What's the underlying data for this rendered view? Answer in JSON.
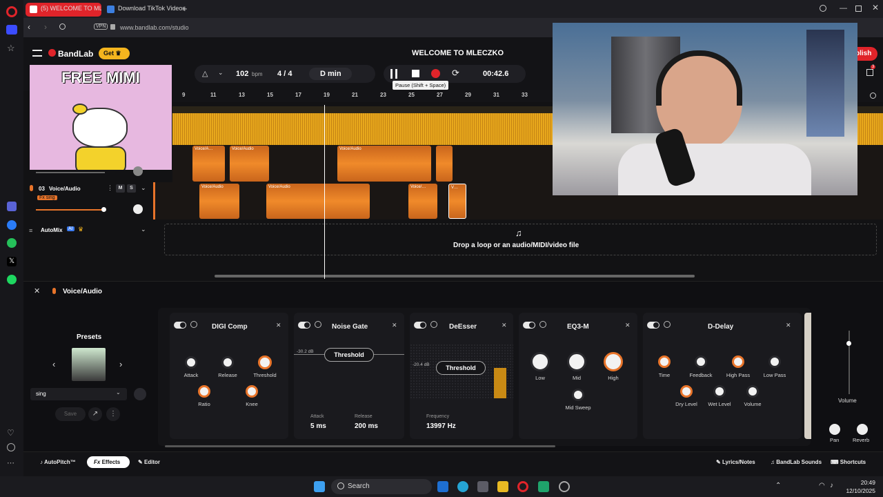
{
  "browser": {
    "tabs": [
      {
        "label": "(5) WELCOME TO MLE…",
        "active": true
      },
      {
        "label": "Download TikTok Videos"
      }
    ],
    "vpn_label": "VPN",
    "url": "www.bandlab.com/studio"
  },
  "studio": {
    "brand": "BandLab",
    "get_label": "Get",
    "project_title": "WELCOME TO MLECZKO",
    "bpm_value": "102",
    "bpm_unit": "bpm",
    "time_sig_num": "4",
    "time_sig_sep": "/",
    "time_sig_den": "4",
    "key": "D min",
    "time": "00:42.6",
    "pause_tooltip": "Pause (Shift + Space)",
    "publish_label": "blish",
    "gift_badge": "3"
  },
  "ruler": [
    "9",
    "11",
    "13",
    "15",
    "17",
    "19",
    "21",
    "23",
    "25",
    "27",
    "29",
    "31",
    "33"
  ],
  "meme": {
    "caption": "FREE MIMI"
  },
  "tracks": [
    {
      "number": "03",
      "name": "Voice/Audio",
      "fx_badge": "Fx sing",
      "mute": "M",
      "solo": "S"
    }
  ],
  "clip_labels": [
    "Voice/A…",
    "Voice/Audio",
    "Voice/Audio",
    "Voice/Audio",
    "Voice/Audio",
    "Voice/…",
    "V…"
  ],
  "automix": {
    "label": "AutoMix",
    "ai": "AI"
  },
  "drop_zone": "Drop a loop or an audio/MIDI/video file",
  "fx_panel": {
    "track_name": "Voice/Audio",
    "presets_title": "Presets",
    "preset_name": "sing",
    "save_label": "Save"
  },
  "effects": {
    "digi_comp": {
      "title": "DIGI Comp",
      "knobs": [
        "Attack",
        "Release",
        "Threshold",
        "Ratio",
        "Knee"
      ]
    },
    "noise_gate": {
      "title": "Noise Gate",
      "db": "-30.2 dB",
      "threshold": "Threshold",
      "attack_label": "Attack",
      "attack_value": "5 ms",
      "release_label": "Release",
      "release_value": "200 ms"
    },
    "deesser": {
      "title": "DeEsser",
      "db": "-20.4 dB",
      "threshold": "Threshold",
      "freq_label": "Frequency",
      "freq_value": "13997 Hz"
    },
    "eq3m": {
      "title": "EQ3-M",
      "knobs": [
        "Low",
        "Mid",
        "High",
        "Mid Sweep"
      ]
    },
    "delay": {
      "title": "D-Delay",
      "knobs": [
        "Time",
        "Feedback",
        "High Pass",
        "Low Pass",
        "Dry Level",
        "Wet Level",
        "Volume"
      ]
    }
  },
  "master": {
    "volume": "Volume",
    "pan": "Pan",
    "reverb": "Reverb",
    "lr": "L  R"
  },
  "bottom_tabs": {
    "autopitch": "AutoPitch™",
    "effects": "Effects",
    "fx": "Fx",
    "editor": "Editor",
    "lyrics": "Lyrics/Notes",
    "sounds": "BandLab Sounds",
    "shortcuts": "Shortcuts"
  },
  "taskbar": {
    "search": "Search",
    "time": "20:49",
    "date": "12/10/2025"
  },
  "colors": {
    "accent": "#f08a2a",
    "gold": "#e8a81c",
    "record": "#e0242a",
    "bg": "#121214"
  }
}
